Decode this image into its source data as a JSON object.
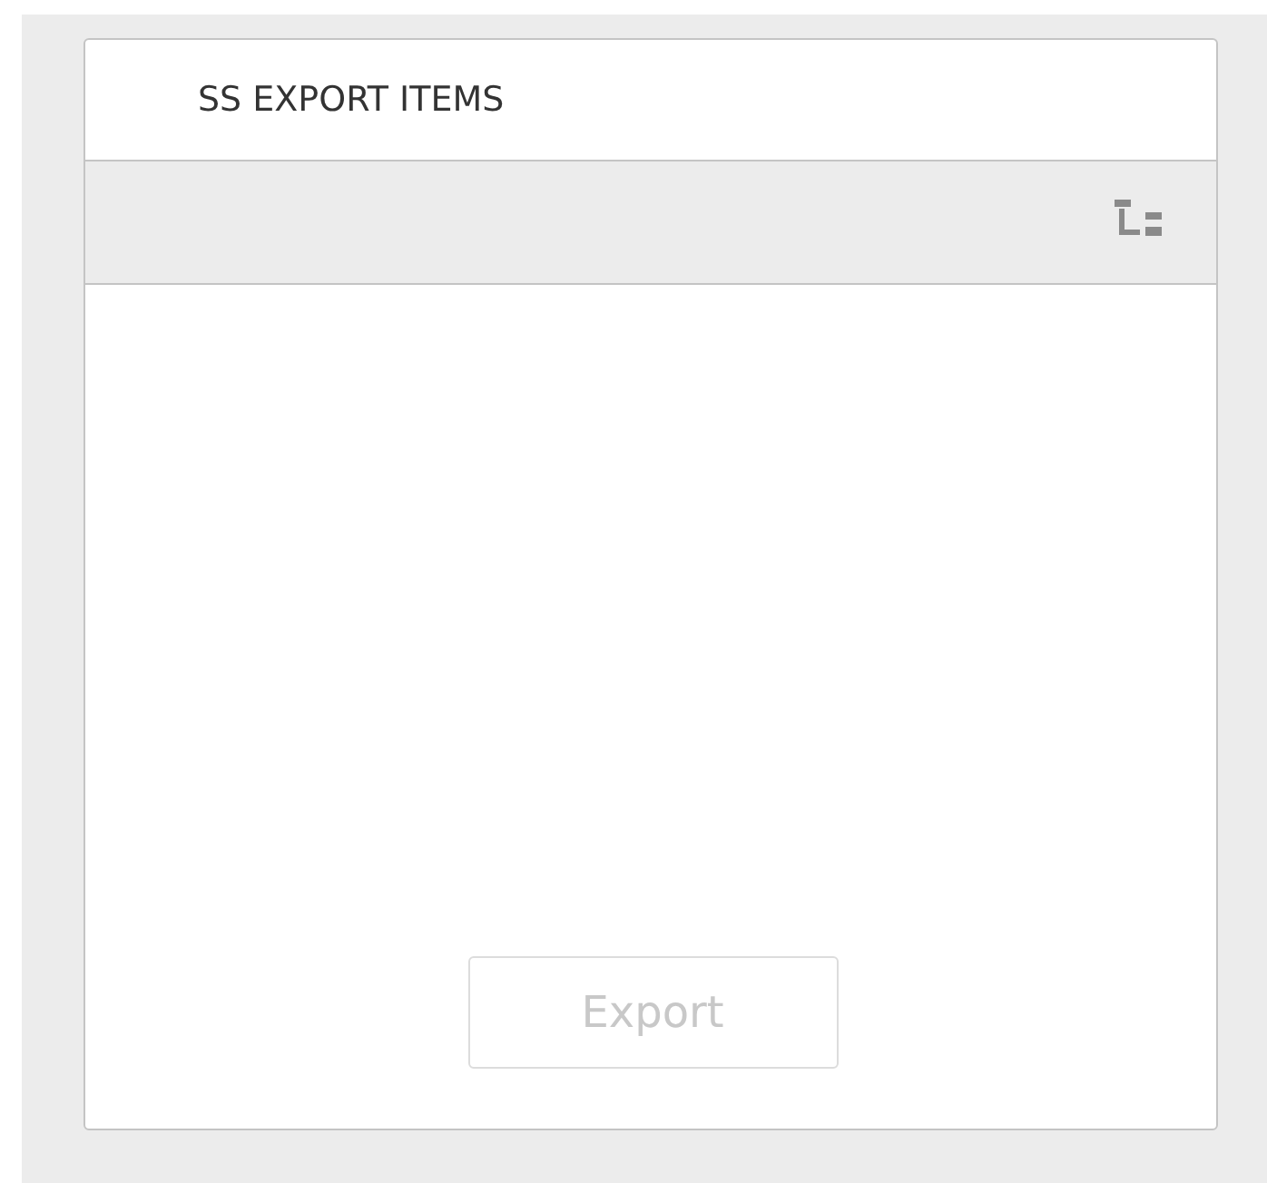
{
  "panel": {
    "title": "SS EXPORT ITEMS"
  },
  "export_button": {
    "label": "Export",
    "disabled": true
  }
}
